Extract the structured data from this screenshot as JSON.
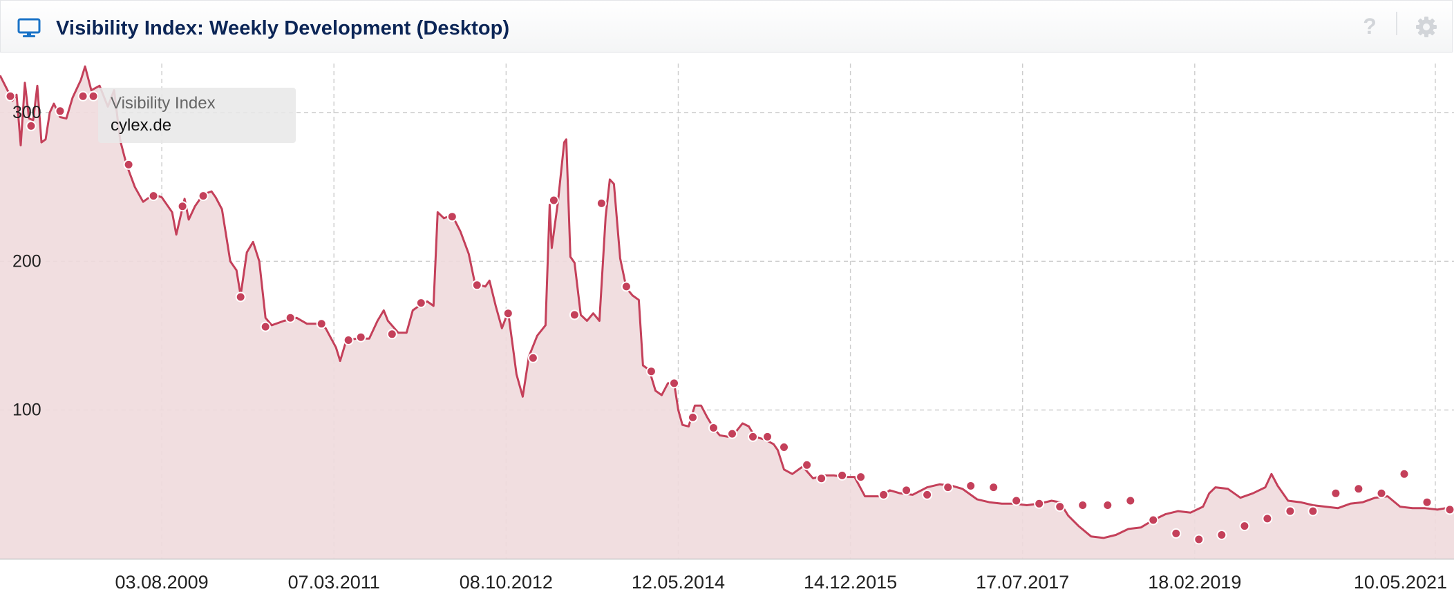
{
  "header": {
    "title": "Visibility Index: Weekly Development (Desktop)",
    "icon": "monitor-icon",
    "help_icon": "help-icon",
    "help_glyph": "?",
    "settings_icon": "gear-icon"
  },
  "tooltip": {
    "label": "Visibility Index",
    "domain": "cylex.de"
  },
  "colors": {
    "line": "#c4405a",
    "fill": "#f0dadd",
    "title": "#0b2556",
    "grid": "#cccccc"
  },
  "chart_data": {
    "type": "area",
    "title": "",
    "xlabel": "",
    "ylabel": "",
    "x_ticks": [
      "03.08.2009",
      "07.03.2011",
      "08.10.2012",
      "12.05.2014",
      "14.12.2015",
      "17.07.2017",
      "18.02.2019",
      "10.05.2021"
    ],
    "y_ticks": [
      100,
      200,
      300
    ],
    "ylim": [
      0,
      330
    ],
    "xlim": [
      "2008-02-04",
      "2021-07-12"
    ],
    "grid": true,
    "legend": "none",
    "series": [
      {
        "values": [
          [
            "2008-02-04",
            325
          ],
          [
            "2008-03-03",
            314
          ],
          [
            "2008-03-17",
            308
          ],
          [
            "2008-03-31",
            312
          ],
          [
            "2008-04-14",
            278
          ],
          [
            "2008-04-28",
            320
          ],
          [
            "2008-05-12",
            296
          ],
          [
            "2008-05-26",
            295
          ],
          [
            "2008-06-09",
            318
          ],
          [
            "2008-06-23",
            280
          ],
          [
            "2008-07-07",
            282
          ],
          [
            "2008-07-21",
            300
          ],
          [
            "2008-08-04",
            306
          ],
          [
            "2008-08-25",
            297
          ],
          [
            "2008-09-15",
            296
          ],
          [
            "2008-10-06",
            310
          ],
          [
            "2008-11-03",
            322
          ],
          [
            "2008-11-17",
            331
          ],
          [
            "2008-12-08",
            315
          ],
          [
            "2009-01-05",
            318
          ],
          [
            "2009-02-02",
            304
          ],
          [
            "2009-02-23",
            315
          ],
          [
            "2009-03-16",
            281
          ],
          [
            "2009-04-06",
            265
          ],
          [
            "2009-05-04",
            250
          ],
          [
            "2009-06-01",
            240
          ],
          [
            "2009-07-06",
            245
          ],
          [
            "2009-08-03",
            243
          ],
          [
            "2009-09-07",
            233
          ],
          [
            "2009-09-21",
            218
          ],
          [
            "2009-10-19",
            242
          ],
          [
            "2009-11-02",
            228
          ],
          [
            "2009-11-23",
            237
          ],
          [
            "2009-12-21",
            245
          ],
          [
            "2010-01-18",
            247
          ],
          [
            "2010-02-01",
            243
          ],
          [
            "2010-02-22",
            235
          ],
          [
            "2010-03-22",
            200
          ],
          [
            "2010-04-12",
            194
          ],
          [
            "2010-04-26",
            177
          ],
          [
            "2010-05-17",
            206
          ],
          [
            "2010-06-07",
            213
          ],
          [
            "2010-06-28",
            200
          ],
          [
            "2010-07-19",
            162
          ],
          [
            "2010-08-09",
            157
          ],
          [
            "2010-09-20",
            160
          ],
          [
            "2010-11-01",
            162
          ],
          [
            "2010-12-06",
            158
          ],
          [
            "2011-01-17",
            158
          ],
          [
            "2011-02-07",
            155
          ],
          [
            "2011-03-14",
            142
          ],
          [
            "2011-03-28",
            133
          ],
          [
            "2011-04-18",
            147
          ],
          [
            "2011-05-23",
            148
          ],
          [
            "2011-07-04",
            148
          ],
          [
            "2011-08-01",
            160
          ],
          [
            "2011-08-22",
            167
          ],
          [
            "2011-09-05",
            160
          ],
          [
            "2011-10-10",
            152
          ],
          [
            "2011-11-07",
            152
          ],
          [
            "2011-11-28",
            167
          ],
          [
            "2011-12-19",
            170
          ],
          [
            "2012-01-16",
            173
          ],
          [
            "2012-02-06",
            170
          ],
          [
            "2012-02-20",
            233
          ],
          [
            "2012-03-12",
            229
          ],
          [
            "2012-04-09",
            231
          ],
          [
            "2012-05-07",
            220
          ],
          [
            "2012-06-04",
            205
          ],
          [
            "2012-06-25",
            185
          ],
          [
            "2012-07-30",
            183
          ],
          [
            "2012-08-13",
            187
          ],
          [
            "2012-09-03",
            170
          ],
          [
            "2012-09-24",
            155
          ],
          [
            "2012-10-15",
            166
          ],
          [
            "2012-10-29",
            145
          ],
          [
            "2012-11-12",
            124
          ],
          [
            "2012-12-03",
            109
          ],
          [
            "2012-12-24",
            136
          ],
          [
            "2013-01-21",
            150
          ],
          [
            "2013-02-18",
            157
          ],
          [
            "2013-03-04",
            238
          ],
          [
            "2013-03-11",
            209
          ],
          [
            "2013-04-01",
            240
          ],
          [
            "2013-04-22",
            280
          ],
          [
            "2013-04-29",
            282
          ],
          [
            "2013-05-13",
            203
          ],
          [
            "2013-05-27",
            199
          ],
          [
            "2013-06-17",
            164
          ],
          [
            "2013-07-08",
            160
          ],
          [
            "2013-07-29",
            165
          ],
          [
            "2013-08-19",
            160
          ],
          [
            "2013-09-09",
            230
          ],
          [
            "2013-09-23",
            255
          ],
          [
            "2013-10-07",
            252
          ],
          [
            "2013-10-28",
            202
          ],
          [
            "2013-11-18",
            182
          ],
          [
            "2013-12-09",
            177
          ],
          [
            "2013-12-30",
            174
          ],
          [
            "2014-01-13",
            130
          ],
          [
            "2014-02-03",
            127
          ],
          [
            "2014-02-24",
            113
          ],
          [
            "2014-03-17",
            110
          ],
          [
            "2014-04-07",
            118
          ],
          [
            "2014-04-28",
            118
          ],
          [
            "2014-05-12",
            100
          ],
          [
            "2014-05-26",
            90
          ],
          [
            "2014-06-16",
            89
          ],
          [
            "2014-07-07",
            103
          ],
          [
            "2014-07-28",
            103
          ],
          [
            "2014-08-18",
            95
          ],
          [
            "2014-09-08",
            88
          ],
          [
            "2014-09-29",
            83
          ],
          [
            "2014-10-27",
            82
          ],
          [
            "2014-11-17",
            84
          ],
          [
            "2014-12-15",
            91
          ],
          [
            "2015-01-05",
            89
          ],
          [
            "2015-01-26",
            82
          ],
          [
            "2015-03-02",
            80
          ],
          [
            "2015-03-30",
            77
          ],
          [
            "2015-04-13",
            73
          ],
          [
            "2015-05-04",
            60
          ],
          [
            "2015-06-01",
            57
          ],
          [
            "2015-07-06",
            62
          ],
          [
            "2015-08-10",
            54
          ],
          [
            "2015-09-14",
            56
          ],
          [
            "2015-10-19",
            56
          ],
          [
            "2015-11-23",
            55
          ],
          [
            "2015-12-28",
            55
          ],
          [
            "2016-02-01",
            42
          ],
          [
            "2016-03-28",
            42
          ],
          [
            "2016-04-25",
            46
          ],
          [
            "2016-05-30",
            44
          ],
          [
            "2016-07-11",
            43
          ],
          [
            "2016-08-29",
            48
          ],
          [
            "2016-10-10",
            50
          ],
          [
            "2016-11-21",
            49
          ],
          [
            "2016-12-26",
            47
          ],
          [
            "2017-02-13",
            40
          ],
          [
            "2017-03-27",
            38
          ],
          [
            "2017-05-08",
            37
          ],
          [
            "2017-06-19",
            37
          ],
          [
            "2017-07-31",
            36
          ],
          [
            "2017-09-11",
            37
          ],
          [
            "2017-10-23",
            39
          ],
          [
            "2017-11-20",
            38
          ],
          [
            "2017-12-18",
            29
          ],
          [
            "2018-01-22",
            22
          ],
          [
            "2018-03-05",
            15
          ],
          [
            "2018-04-16",
            14
          ],
          [
            "2018-05-28",
            16
          ],
          [
            "2018-07-09",
            20
          ],
          [
            "2018-08-20",
            21
          ],
          [
            "2018-10-01",
            26
          ],
          [
            "2018-11-12",
            30
          ],
          [
            "2018-12-24",
            32
          ],
          [
            "2019-02-04",
            31
          ],
          [
            "2019-03-18",
            35
          ],
          [
            "2019-04-08",
            44
          ],
          [
            "2019-04-29",
            48
          ],
          [
            "2019-06-10",
            47
          ],
          [
            "2019-07-22",
            41
          ],
          [
            "2019-09-02",
            44
          ],
          [
            "2019-10-14",
            48
          ],
          [
            "2019-11-04",
            57
          ],
          [
            "2019-11-25",
            49
          ],
          [
            "2019-12-30",
            39
          ],
          [
            "2020-02-10",
            38
          ],
          [
            "2020-03-23",
            36
          ],
          [
            "2020-05-04",
            35
          ],
          [
            "2020-06-15",
            34
          ],
          [
            "2020-07-27",
            37
          ],
          [
            "2020-09-07",
            38
          ],
          [
            "2020-10-19",
            41
          ],
          [
            "2020-11-30",
            42
          ],
          [
            "2021-01-11",
            35
          ],
          [
            "2021-02-22",
            34
          ],
          [
            "2021-04-05",
            34
          ],
          [
            "2021-05-17",
            33
          ],
          [
            "2021-06-14",
            34
          ],
          [
            "2021-07-12",
            32
          ]
        ],
        "markers": [
          [
            "2008-03-10",
            311
          ],
          [
            "2008-05-19",
            291
          ],
          [
            "2008-08-25",
            301
          ],
          [
            "2008-11-10",
            311
          ],
          [
            "2008-12-15",
            311
          ],
          [
            "2009-04-13",
            265
          ],
          [
            "2009-07-06",
            244
          ],
          [
            "2009-10-12",
            237
          ],
          [
            "2009-12-21",
            244
          ],
          [
            "2010-04-26",
            176
          ],
          [
            "2010-07-19",
            156
          ],
          [
            "2010-10-11",
            162
          ],
          [
            "2011-01-24",
            158
          ],
          [
            "2011-04-25",
            147
          ],
          [
            "2011-06-06",
            149
          ],
          [
            "2011-09-19",
            151
          ],
          [
            "2011-12-26",
            172
          ],
          [
            "2012-04-09",
            230
          ],
          [
            "2012-07-02",
            184
          ],
          [
            "2012-10-15",
            165
          ],
          [
            "2013-01-07",
            135
          ],
          [
            "2013-03-18",
            241
          ],
          [
            "2013-05-27",
            164
          ],
          [
            "2013-08-26",
            239
          ],
          [
            "2013-11-18",
            183
          ],
          [
            "2014-02-10",
            126
          ],
          [
            "2014-04-28",
            118
          ],
          [
            "2014-06-30",
            95
          ],
          [
            "2014-09-08",
            88
          ],
          [
            "2014-11-10",
            84
          ],
          [
            "2015-01-19",
            82
          ],
          [
            "2015-03-09",
            82
          ],
          [
            "2015-05-04",
            75
          ],
          [
            "2015-07-20",
            63
          ],
          [
            "2015-09-07",
            54
          ],
          [
            "2015-11-16",
            56
          ],
          [
            "2016-01-18",
            55
          ],
          [
            "2016-04-04",
            43
          ],
          [
            "2016-06-20",
            46
          ],
          [
            "2016-08-29",
            43
          ],
          [
            "2016-11-07",
            48
          ],
          [
            "2017-01-23",
            49
          ],
          [
            "2017-04-10",
            48
          ],
          [
            "2017-06-26",
            39
          ],
          [
            "2017-09-11",
            37
          ],
          [
            "2017-11-20",
            35
          ],
          [
            "2018-02-05",
            36
          ],
          [
            "2018-04-30",
            36
          ],
          [
            "2018-07-16",
            39
          ],
          [
            "2018-10-01",
            26
          ],
          [
            "2018-12-17",
            17
          ],
          [
            "2019-03-04",
            13
          ],
          [
            "2019-05-20",
            16
          ],
          [
            "2019-08-05",
            22
          ],
          [
            "2019-10-21",
            27
          ],
          [
            "2020-01-06",
            32
          ],
          [
            "2020-03-23",
            32
          ],
          [
            "2020-06-08",
            44
          ],
          [
            "2020-08-24",
            47
          ],
          [
            "2020-11-09",
            44
          ],
          [
            "2021-01-25",
            57
          ],
          [
            "2021-04-12",
            38
          ],
          [
            "2021-06-28",
            33
          ]
        ]
      }
    ]
  }
}
